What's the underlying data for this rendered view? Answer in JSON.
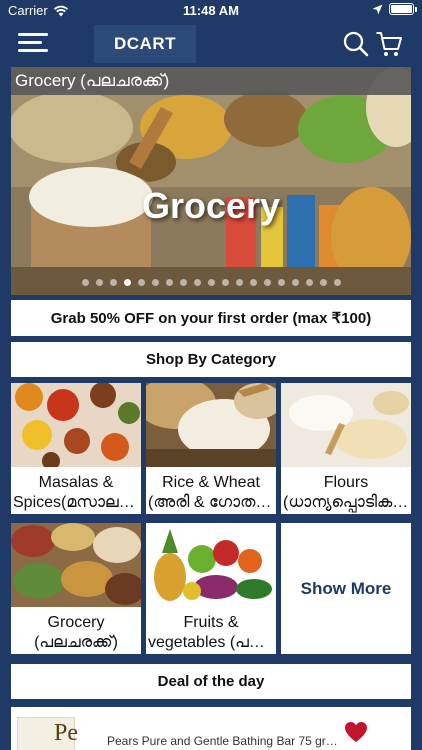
{
  "status_bar": {
    "carrier": "Carrier",
    "time": "11:48 AM",
    "battery_level": 1.0
  },
  "app": {
    "logo_text": "DCART"
  },
  "colors": {
    "background": "#1f3a66",
    "heart": "#c0152c",
    "show_more_text": "#1f3a66"
  },
  "banner": {
    "title": "Grocery (പലചരക്ക്)",
    "center_text": "Grocery",
    "page_count": 19,
    "active_page": 3
  },
  "promo": {
    "text": "Grab 50% OFF on your first order (max ₹100)"
  },
  "shop_by_category": {
    "heading": "Shop By Category"
  },
  "categories": [
    {
      "line1": "Masalas &",
      "line2": "Spices(മസാലക…",
      "icon": "spices-photo"
    },
    {
      "line1": "Rice & Wheat",
      "line2": "(അരി & ഗോതമ്പ്)",
      "icon": "rice-photo"
    },
    {
      "line1": "Flours",
      "line2": "(ധാന്യപ്പൊടികൾ)",
      "icon": "flour-photo"
    },
    {
      "line1": "Grocery",
      "line2": "(പലചരക്ക്)",
      "icon": "grocery-photo"
    },
    {
      "line1": "Fruits &",
      "line2": "vegetables (പഴ…",
      "icon": "fruits-photo"
    }
  ],
  "show_more": {
    "label": "Show More"
  },
  "deal": {
    "heading": "Deal of the day"
  },
  "product": {
    "name": "Pears Pure and Gentle Bathing Bar 75 gr…",
    "thumb_text": "Pe",
    "favorite": true
  }
}
